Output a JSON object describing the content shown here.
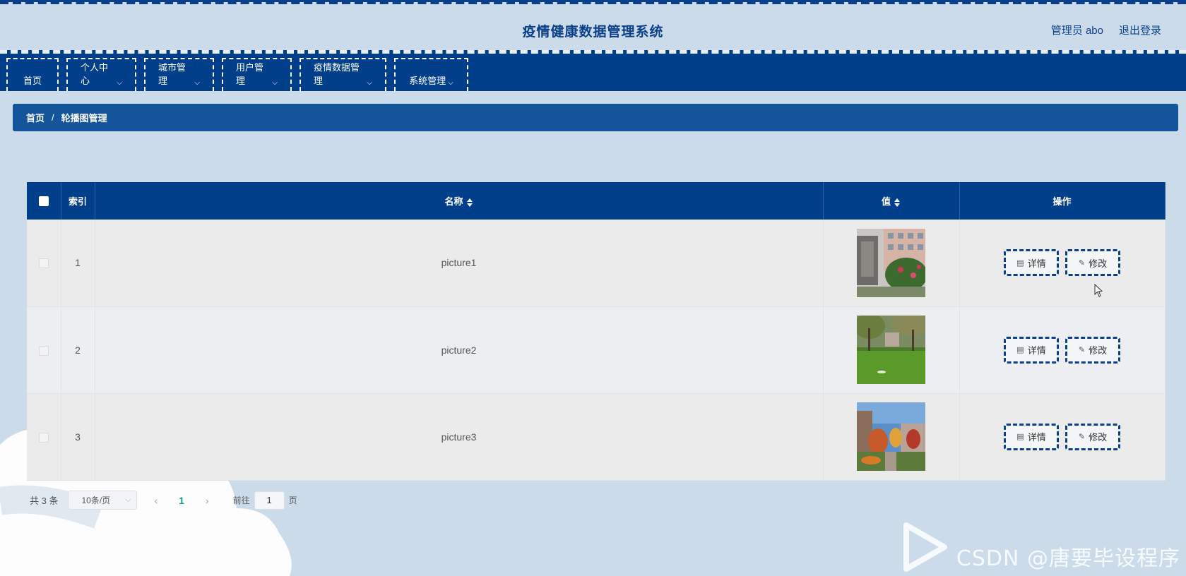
{
  "header": {
    "title": "疫情健康数据管理系统",
    "user_label": "管理员 abo",
    "logout_label": "退出登录"
  },
  "nav": {
    "items": [
      {
        "label": "首页",
        "has_dropdown": false
      },
      {
        "label": "个人中心",
        "has_dropdown": true
      },
      {
        "label": "城市管理",
        "has_dropdown": true
      },
      {
        "label": "用户管理",
        "has_dropdown": true
      },
      {
        "label": "疫情数据管理",
        "has_dropdown": true
      },
      {
        "label": "系统管理",
        "has_dropdown": true
      }
    ]
  },
  "breadcrumb": {
    "home": "首页",
    "separator": "/",
    "current": "轮播图管理"
  },
  "table": {
    "columns": {
      "index": "索引",
      "name": "名称",
      "value": "值",
      "actions": "操作"
    },
    "rows": [
      {
        "index": "1",
        "name": "picture1",
        "image": "building-garden"
      },
      {
        "index": "2",
        "name": "picture2",
        "image": "lawn-trees"
      },
      {
        "index": "3",
        "name": "picture3",
        "image": "campus-autumn"
      }
    ],
    "detail_label": "详情",
    "edit_label": "修改"
  },
  "pagination": {
    "total_text": "共 3 条",
    "page_size": "10条/页",
    "current_page": "1",
    "goto_prefix": "前往",
    "goto_value": "1",
    "goto_suffix": "页"
  },
  "watermark": "CSDN @唐要毕设程序",
  "colors": {
    "navy": "#023f8b",
    "breadcrumb": "#14549a",
    "background": "#cbdbe9",
    "active_page": "#13a08a"
  }
}
